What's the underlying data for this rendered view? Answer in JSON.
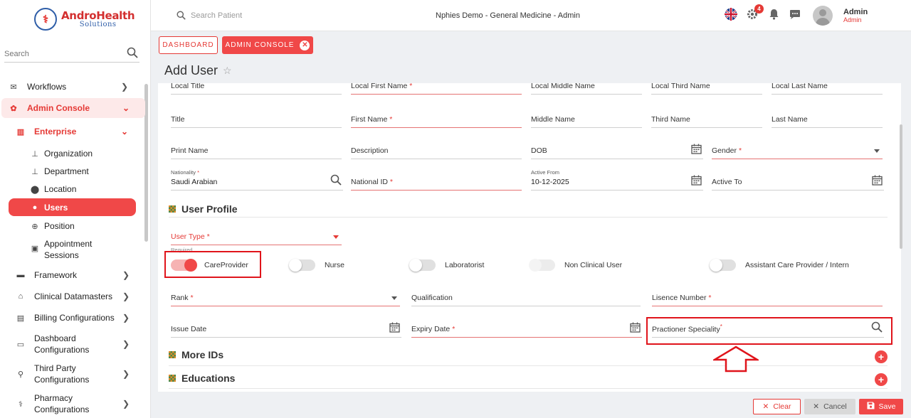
{
  "brand": {
    "name": "AndroHealth",
    "tagline": "Solutions"
  },
  "sidebar": {
    "search_placeholder": "Search",
    "items": [
      {
        "label": "Workflows"
      },
      {
        "label": "Admin Console"
      },
      {
        "label": "Enterprise"
      },
      {
        "label": "Organization"
      },
      {
        "label": "Department"
      },
      {
        "label": "Location"
      },
      {
        "label": "Users"
      },
      {
        "label": "Position"
      },
      {
        "label": "Appointment",
        "label2": "Sessions"
      },
      {
        "label": "Framework"
      },
      {
        "label": "Clinical Datamasters"
      },
      {
        "label": "Billing Configurations"
      },
      {
        "label": "Dashboard",
        "label2": "Configurations"
      },
      {
        "label": "Third Party",
        "label2": "Configurations"
      },
      {
        "label": "Pharmacy",
        "label2": "Configurations"
      }
    ]
  },
  "header": {
    "search_placeholder": "Search Patient",
    "context": "Nphies Demo - General Medicine - Admin",
    "notification_count": "4",
    "user_name": "Admin",
    "user_role": "Admin"
  },
  "tabs": {
    "dashboard": "DASHBOARD",
    "admin_console": "ADMIN CONSOLE"
  },
  "page": {
    "title": "Add User"
  },
  "form": {
    "row0": {
      "local_title": "Local Title",
      "local_first_name": "Local First Name",
      "local_middle_name": "Local Middle Name",
      "local_third_name": "Local Third Name",
      "local_last_name": "Local Last Name"
    },
    "row1": {
      "title": "Title",
      "first_name": "First Name",
      "middle_name": "Middle Name",
      "third_name": "Third Name",
      "last_name": "Last Name"
    },
    "row2": {
      "print_name": "Print Name",
      "description": "Description",
      "dob": "DOB",
      "gender": "Gender"
    },
    "row3": {
      "nationality_label": "Nationality",
      "nationality_value": "Saudi Arabian",
      "national_id": "National ID",
      "active_from_label": "Active From",
      "active_from_value": "10-12-2025",
      "active_to": "Active To"
    },
    "user_profile_title": "User Profile",
    "user_type": "User Type",
    "required_hint": "Required",
    "toggles": [
      {
        "label": "CareProvider",
        "state": "on"
      },
      {
        "label": "Nurse",
        "state": "off"
      },
      {
        "label": "Laboratorist",
        "state": "off"
      },
      {
        "label": "Non Clinical User",
        "state": "disabled"
      },
      {
        "label": "Assistant Care Provider / Intern",
        "state": "off"
      }
    ],
    "rank": "Rank",
    "qualification": "Qualification",
    "licence_number": "Lisence Number",
    "issue_date": "Issue Date",
    "expiry_date": "Expiry Date",
    "practitioner_speciality": "Practioner Speciality",
    "more_ids_title": "More IDs",
    "educations_title": "Educations"
  },
  "actions": {
    "clear": "Clear",
    "cancel": "Cancel",
    "save": "Save"
  },
  "colors": {
    "accent": "#f04848",
    "highlight": "#e0141b"
  }
}
